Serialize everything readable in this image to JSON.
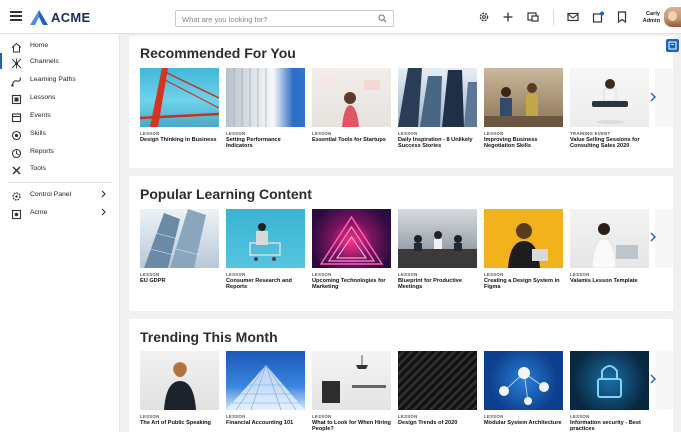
{
  "header": {
    "brand": "ACME",
    "search_placeholder": "What are you looking for?",
    "user_name_line1": "Carly",
    "user_name_line2": "Admin"
  },
  "sidebar": {
    "items": [
      {
        "label": "Home",
        "icon": "home-icon"
      },
      {
        "label": "Channels",
        "icon": "channels-icon"
      },
      {
        "label": "Learning Paths",
        "icon": "learning-paths-icon"
      },
      {
        "label": "Lessons",
        "icon": "lessons-icon"
      },
      {
        "label": "Events",
        "icon": "calendar-icon"
      },
      {
        "label": "Skills",
        "icon": "skills-icon"
      },
      {
        "label": "Reports",
        "icon": "reports-icon"
      },
      {
        "label": "Tools",
        "icon": "tools-icon"
      },
      {
        "label": "Control Panel",
        "icon": "gear-icon"
      },
      {
        "label": "Acme",
        "icon": "acme-icon"
      }
    ]
  },
  "sections": [
    {
      "title": "Recommended For You",
      "cards": [
        {
          "kind": "LESSON",
          "title": "Design Thinking in Business"
        },
        {
          "kind": "LESSON",
          "title": "Setting Performance Indicators"
        },
        {
          "kind": "LESSON",
          "title": "Essential Tools for Startups"
        },
        {
          "kind": "LESSON",
          "title": "Daily Inspiration - 8 Unlikely Success Stories"
        },
        {
          "kind": "LESSON",
          "title": "Improving Business Negotiation Skills"
        },
        {
          "kind": "TRAINING EVENT",
          "title": "Value Selling Sessions for Consulting Sales 2020"
        }
      ]
    },
    {
      "title": "Popular Learning Content",
      "cards": [
        {
          "kind": "LESSON",
          "title": "EU GDPR"
        },
        {
          "kind": "LESSON",
          "title": "Consumer Research and Reports"
        },
        {
          "kind": "LESSON",
          "title": "Upcoming Technologies for Marketing"
        },
        {
          "kind": "LESSON",
          "title": "Blueprint for Productive Meetings"
        },
        {
          "kind": "LESSON",
          "title": "Creating a Design System in Figma"
        },
        {
          "kind": "LESSON",
          "title": "Valamis Lesson Template"
        }
      ]
    },
    {
      "title": "Trending This Month",
      "cards": [
        {
          "kind": "LESSON",
          "title": "The Art of Public Speaking"
        },
        {
          "kind": "LESSON",
          "title": "Financial Accounting 101"
        },
        {
          "kind": "LESSON",
          "title": "What to Look for When Hiring People?"
        },
        {
          "kind": "LESSON",
          "title": "Design Trends of 2020"
        },
        {
          "kind": "LESSON",
          "title": "Modular System Architecture"
        },
        {
          "kind": "LESSON",
          "title": "Information security - Best practices"
        }
      ]
    }
  ],
  "colors": {
    "accent": "#1b62c7",
    "brand_text": "#1a2b5c"
  }
}
